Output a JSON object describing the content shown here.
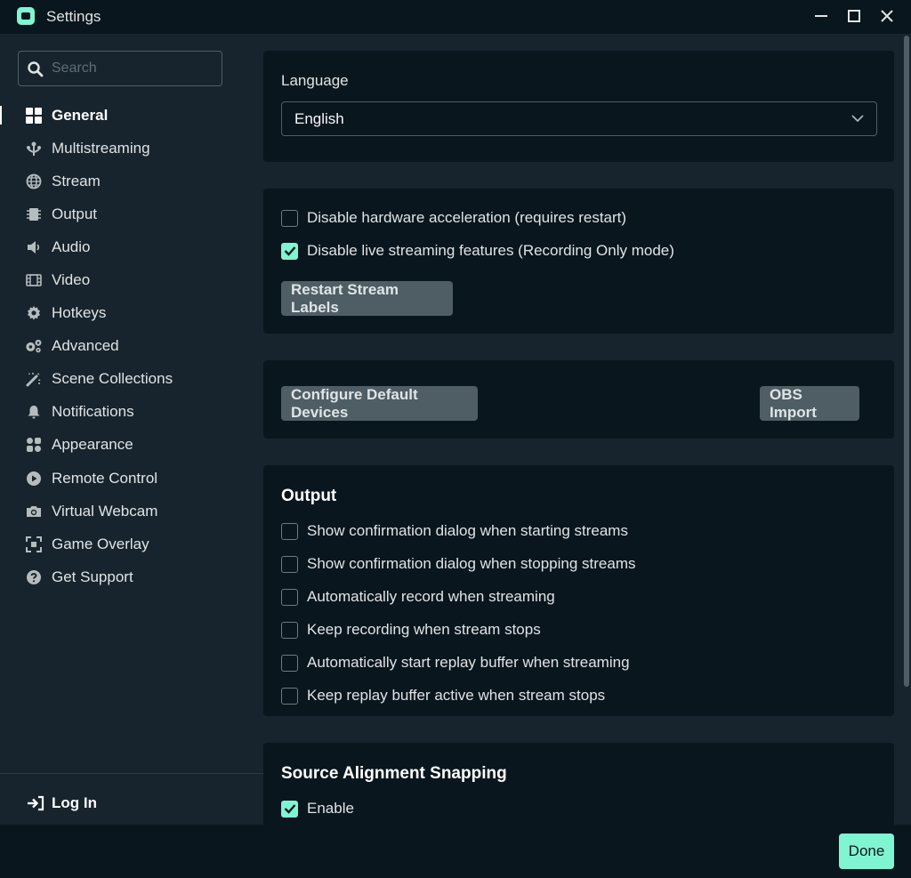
{
  "window": {
    "title": "Settings"
  },
  "colors": {
    "accent": "#80f5d2",
    "background": "#09161d",
    "section": "#17242d",
    "button": "#4f5e65"
  },
  "search": {
    "placeholder": "Search",
    "value": ""
  },
  "sidebar": {
    "items": [
      {
        "label": "General",
        "icon": "grid-icon",
        "active": true
      },
      {
        "label": "Multistreaming",
        "icon": "multistream-icon"
      },
      {
        "label": "Stream",
        "icon": "globe-icon"
      },
      {
        "label": "Output",
        "icon": "output-icon"
      },
      {
        "label": "Audio",
        "icon": "speaker-icon"
      },
      {
        "label": "Video",
        "icon": "film-icon"
      },
      {
        "label": "Hotkeys",
        "icon": "gear-icon"
      },
      {
        "label": "Advanced",
        "icon": "gears-icon"
      },
      {
        "label": "Scene Collections",
        "icon": "wand-icon"
      },
      {
        "label": "Notifications",
        "icon": "bell-icon"
      },
      {
        "label": "Appearance",
        "icon": "palette-icon"
      },
      {
        "label": "Remote Control",
        "icon": "play-circle-icon"
      },
      {
        "label": "Virtual Webcam",
        "icon": "camera-icon"
      },
      {
        "label": "Game Overlay",
        "icon": "expand-icon"
      },
      {
        "label": "Get Support",
        "icon": "question-icon"
      }
    ],
    "login_label": "Log In"
  },
  "general": {
    "language_label": "Language",
    "language_value": "English",
    "checkboxes": [
      {
        "label": "Disable hardware acceleration (requires restart)",
        "checked": false
      },
      {
        "label": "Disable live streaming features (Recording Only mode)",
        "checked": true
      }
    ],
    "restart_button": "Restart Stream Labels",
    "configure_button": "Configure Default Devices",
    "obs_button": "OBS Import"
  },
  "output": {
    "title": "Output",
    "options": [
      {
        "label": "Show confirmation dialog when starting streams",
        "checked": false
      },
      {
        "label": "Show confirmation dialog when stopping streams",
        "checked": false
      },
      {
        "label": "Automatically record when streaming",
        "checked": false
      },
      {
        "label": "Keep recording when stream stops",
        "checked": false
      },
      {
        "label": "Automatically start replay buffer when streaming",
        "checked": false
      },
      {
        "label": "Keep replay buffer active when stream stops",
        "checked": false
      }
    ]
  },
  "snapping": {
    "title": "Source Alignment Snapping",
    "enable_label": "Enable",
    "enable_checked": true
  },
  "footer": {
    "done_label": "Done"
  }
}
